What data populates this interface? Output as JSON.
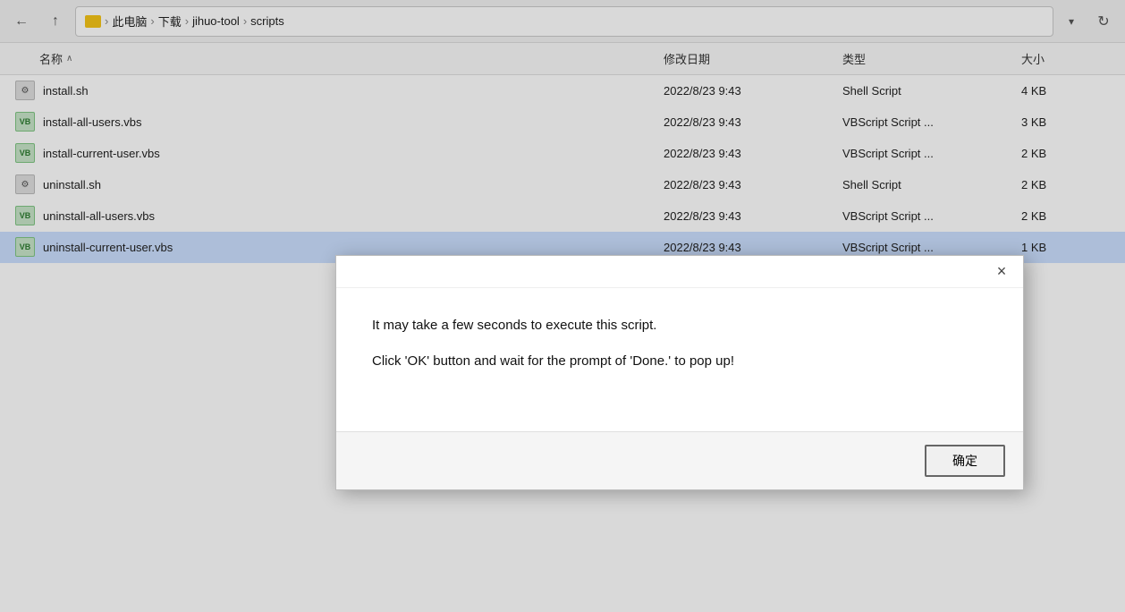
{
  "addressBar": {
    "backLabel": "←",
    "upLabel": "↑",
    "breadcrumbs": [
      "此电脑",
      "下载",
      "jihuo-tool",
      "scripts"
    ],
    "dropdownLabel": "▾",
    "refreshLabel": "↻"
  },
  "fileList": {
    "headers": {
      "name": "名称",
      "modified": "修改日期",
      "type": "类型",
      "size": "大小"
    },
    "sortArrow": "∧",
    "files": [
      {
        "name": "install.sh",
        "iconType": "sh",
        "modified": "2022/8/23 9:43",
        "type": "Shell Script",
        "size": "4 KB",
        "selected": false
      },
      {
        "name": "install-all-users.vbs",
        "iconType": "vbs",
        "modified": "2022/8/23 9:43",
        "type": "VBScript Script ...",
        "size": "3 KB",
        "selected": false
      },
      {
        "name": "install-current-user.vbs",
        "iconType": "vbs",
        "modified": "2022/8/23 9:43",
        "type": "VBScript Script ...",
        "size": "2 KB",
        "selected": false
      },
      {
        "name": "uninstall.sh",
        "iconType": "sh",
        "modified": "2022/8/23 9:43",
        "type": "Shell Script",
        "size": "2 KB",
        "selected": false
      },
      {
        "name": "uninstall-all-users.vbs",
        "iconType": "vbs",
        "modified": "2022/8/23 9:43",
        "type": "VBScript Script ...",
        "size": "2 KB",
        "selected": false
      },
      {
        "name": "uninstall-current-user.vbs",
        "iconType": "vbs",
        "modified": "2022/8/23 9:43",
        "type": "VBScript Script ...",
        "size": "1 KB",
        "selected": true
      }
    ]
  },
  "dialog": {
    "closeLabel": "×",
    "line1": "It may take a few seconds to execute this script.",
    "line2": "Click 'OK' button and wait for the prompt of 'Done.' to pop up!",
    "okLabel": "确定"
  }
}
